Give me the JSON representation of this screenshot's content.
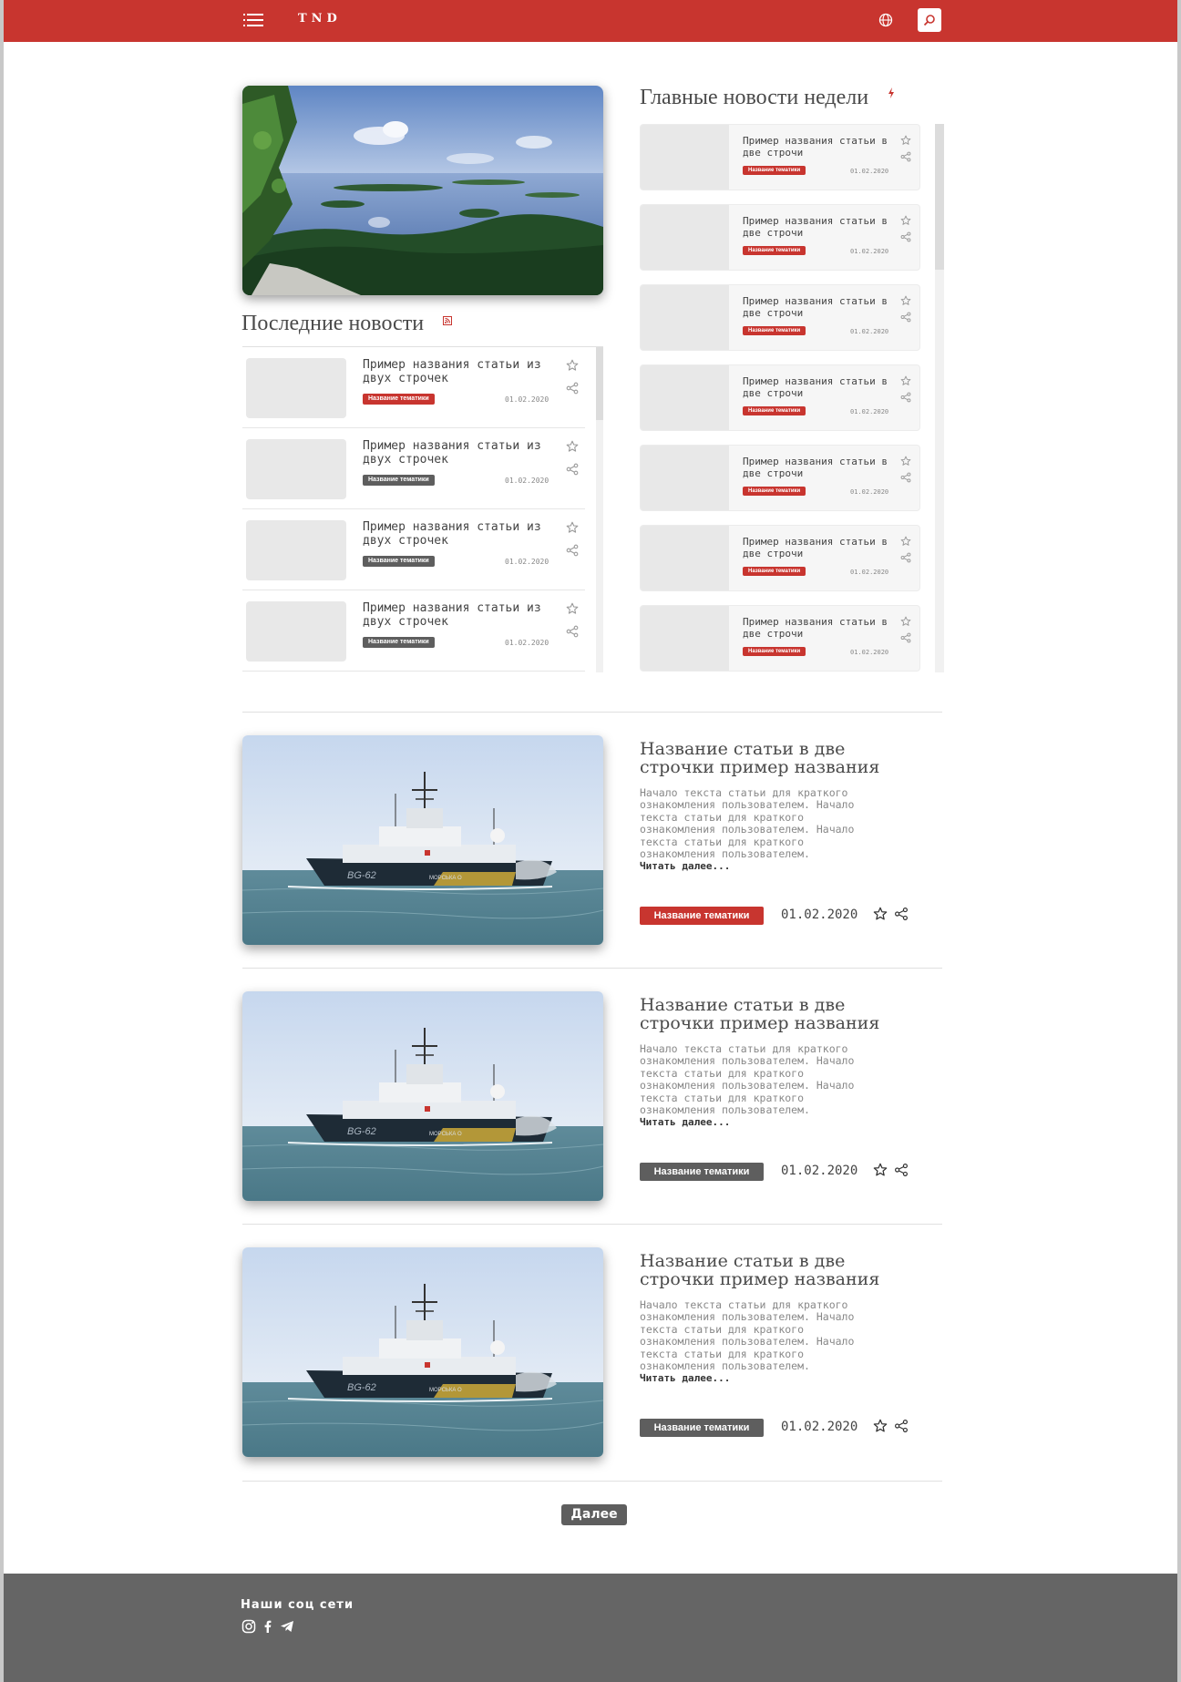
{
  "header": {
    "logo": "TND"
  },
  "hero": {
    "alt": "lake landscape"
  },
  "latest": {
    "title": "Последние новости",
    "items": [
      {
        "title": "Пример названия статьи из двух строчек",
        "tag": "Название тематики",
        "tag_color": "#c8352f",
        "date": "01.02.2020"
      },
      {
        "title": "Пример названия статьи из двух строчек",
        "tag": "Название тематики",
        "tag_color": "#5e5e5e",
        "date": "01.02.2020"
      },
      {
        "title": "Пример названия статьи из двух строчек",
        "tag": "Название тематики",
        "tag_color": "#5e5e5e",
        "date": "01.02.2020"
      },
      {
        "title": "Пример названия статьи из двух строчек",
        "tag": "Название тематики",
        "tag_color": "#5e5e5e",
        "date": "01.02.2020"
      }
    ]
  },
  "weekly": {
    "title": "Главные новости недели",
    "items": [
      {
        "title": "Пример названия статьи в две строчи",
        "tag": "Название тематики",
        "date": "01.02.2020"
      },
      {
        "title": "Пример названия статьи в две строчи",
        "tag": "Название тематики",
        "date": "01.02.2020"
      },
      {
        "title": "Пример названия статьи в две строчи",
        "tag": "Название тематики",
        "date": "01.02.2020"
      },
      {
        "title": "Пример названия статьи в две строчи",
        "tag": "Название тематики",
        "date": "01.02.2020"
      },
      {
        "title": "Пример названия статьи в две строчи",
        "tag": "Название тематики",
        "date": "01.02.2020"
      },
      {
        "title": "Пример названия статьи в две строчи",
        "tag": "Название тематики",
        "date": "01.02.2020"
      },
      {
        "title": "Пример названия статьи в две строчи",
        "tag": "Название тематики",
        "date": "01.02.2020"
      }
    ]
  },
  "articles": [
    {
      "title": "Название статьи в две строчки пример названия",
      "text": "Начало текста статьи для краткого ознакомления пользователем. Начало текста статьи для краткого ознакомления пользователем. Начало текста статьи для краткого ознакомления пользователем.",
      "more": "Читать далее...",
      "tag": "Название тематики",
      "tag_color": "#c8352f",
      "date": "01.02.2020",
      "ship_label": "BG-62",
      "ship_side": "МОРСЬКА О"
    },
    {
      "title": "Название статьи в две строчки пример названия",
      "text": "Начало текста статьи для краткого ознакомления пользователем. Начало текста статьи для краткого ознакомления пользователем. Начало текста статьи для краткого ознакомления пользователем.",
      "more": "Читать далее...",
      "tag": "Название тематики",
      "tag_color": "#5e5e5e",
      "date": "01.02.2020",
      "ship_label": "BG-62",
      "ship_side": "МОРСЬКА О"
    },
    {
      "title": "Название статьи в две строчки пример названия",
      "text": "Начало текста статьи для краткого ознакомления пользователем. Начало текста статьи для краткого ознакомления пользователем. Начало текста статьи для краткого ознакомления пользователем.",
      "more": "Читать далее...",
      "tag": "Название тематики",
      "tag_color": "#5e5e5e",
      "date": "01.02.2020",
      "ship_label": "BG-62",
      "ship_side": "МОРСЬКА О"
    }
  ],
  "pagination": {
    "next_label": "Далее"
  },
  "footer": {
    "title": "Наши соц сети",
    "socials": [
      "instagram-icon",
      "facebook-icon",
      "telegram-icon"
    ]
  }
}
